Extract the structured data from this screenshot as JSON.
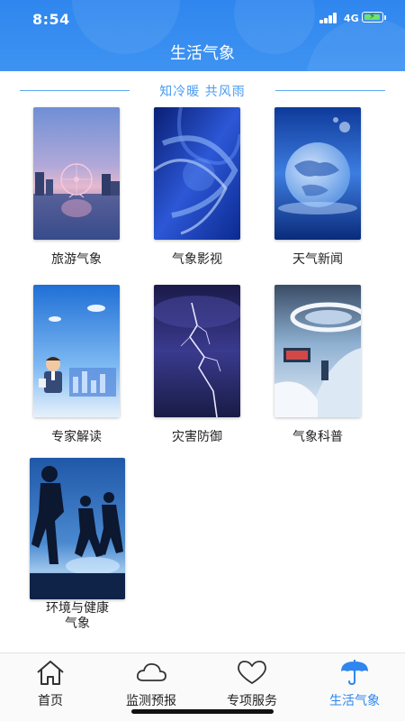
{
  "status_bar": {
    "time": "8:54",
    "network": "4G"
  },
  "header": {
    "title": "生活气象",
    "background": "#2f86ee"
  },
  "tagline": "知冷暖 共风雨",
  "tiles": [
    {
      "label": "旅游气象",
      "image": "city-ferris-wheel-night"
    },
    {
      "label": "气象影视",
      "image": "abstract-blue-swirl"
    },
    {
      "label": "天气新闻",
      "image": "globe-splash"
    },
    {
      "label": "专家解读",
      "image": "cartoon-expert-with-chart"
    },
    {
      "label": "灾害防御",
      "image": "lightning-storm"
    },
    {
      "label": "气象科普",
      "image": "science-museum-hall"
    },
    {
      "label": "环境与健康\n气象",
      "image": "runners-silhouette-dusk"
    }
  ],
  "tabs": [
    {
      "label": "首页",
      "icon": "home-icon",
      "active": false
    },
    {
      "label": "监测预报",
      "icon": "cloud-icon",
      "active": false
    },
    {
      "label": "专项服务",
      "icon": "heart-icon",
      "active": false
    },
    {
      "label": "生活气象",
      "icon": "umbrella-icon",
      "active": true
    }
  ],
  "colors": {
    "accent": "#2f86ee",
    "tagline": "#4a9cf0",
    "tab_active": "#2f86ee",
    "tab_inactive": "#222222"
  }
}
